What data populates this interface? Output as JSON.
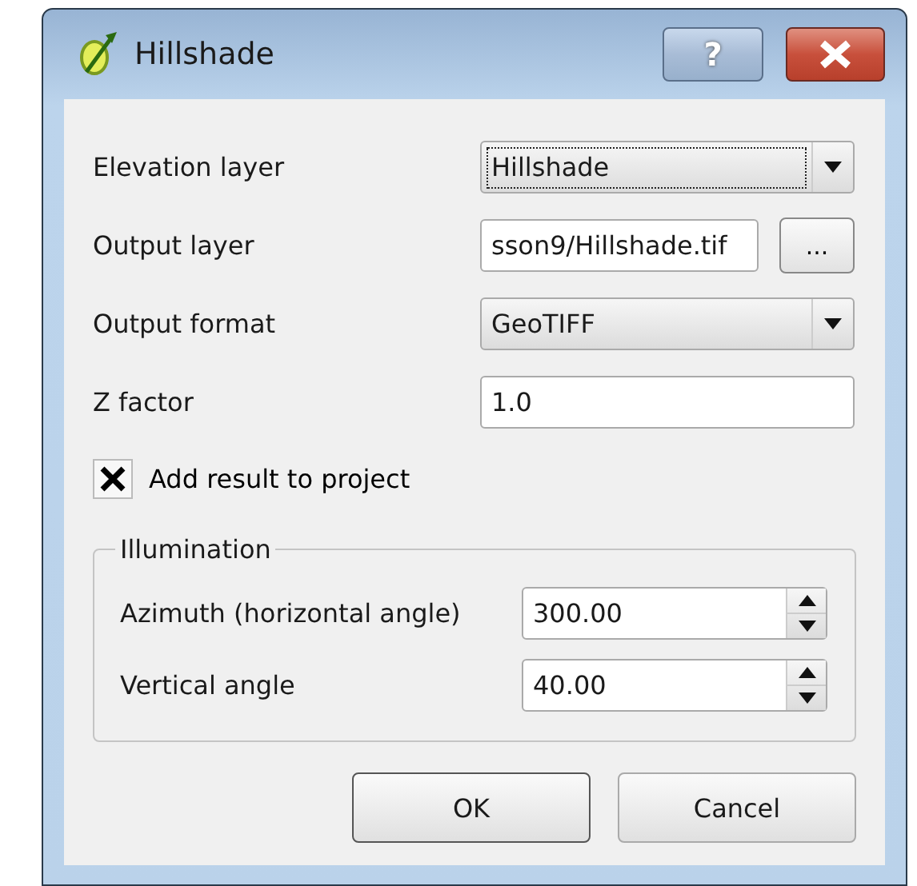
{
  "window": {
    "title": "Hillshade",
    "help_label": "?"
  },
  "fields": [
    {
      "kind": "combo",
      "label": "Elevation layer",
      "value": "Hillshade",
      "focused": true
    },
    {
      "kind": "file",
      "label": "Output layer",
      "value": "sson9/Hillshade.tif",
      "browse": "..."
    },
    {
      "kind": "combo",
      "label": "Output format",
      "value": "GeoTIFF",
      "focused": false
    },
    {
      "kind": "text",
      "label": "Z factor",
      "value": "1.0"
    }
  ],
  "add_to_project": {
    "label": "Add result to project",
    "checked": true
  },
  "illumination": {
    "title": "Illumination",
    "fields": [
      {
        "label": "Azimuth (horizontal angle)",
        "value": "300.00"
      },
      {
        "label": "Vertical angle",
        "value": "40.00"
      }
    ]
  },
  "buttons": [
    {
      "label": "OK",
      "default": true
    },
    {
      "label": "Cancel",
      "default": false
    }
  ]
}
